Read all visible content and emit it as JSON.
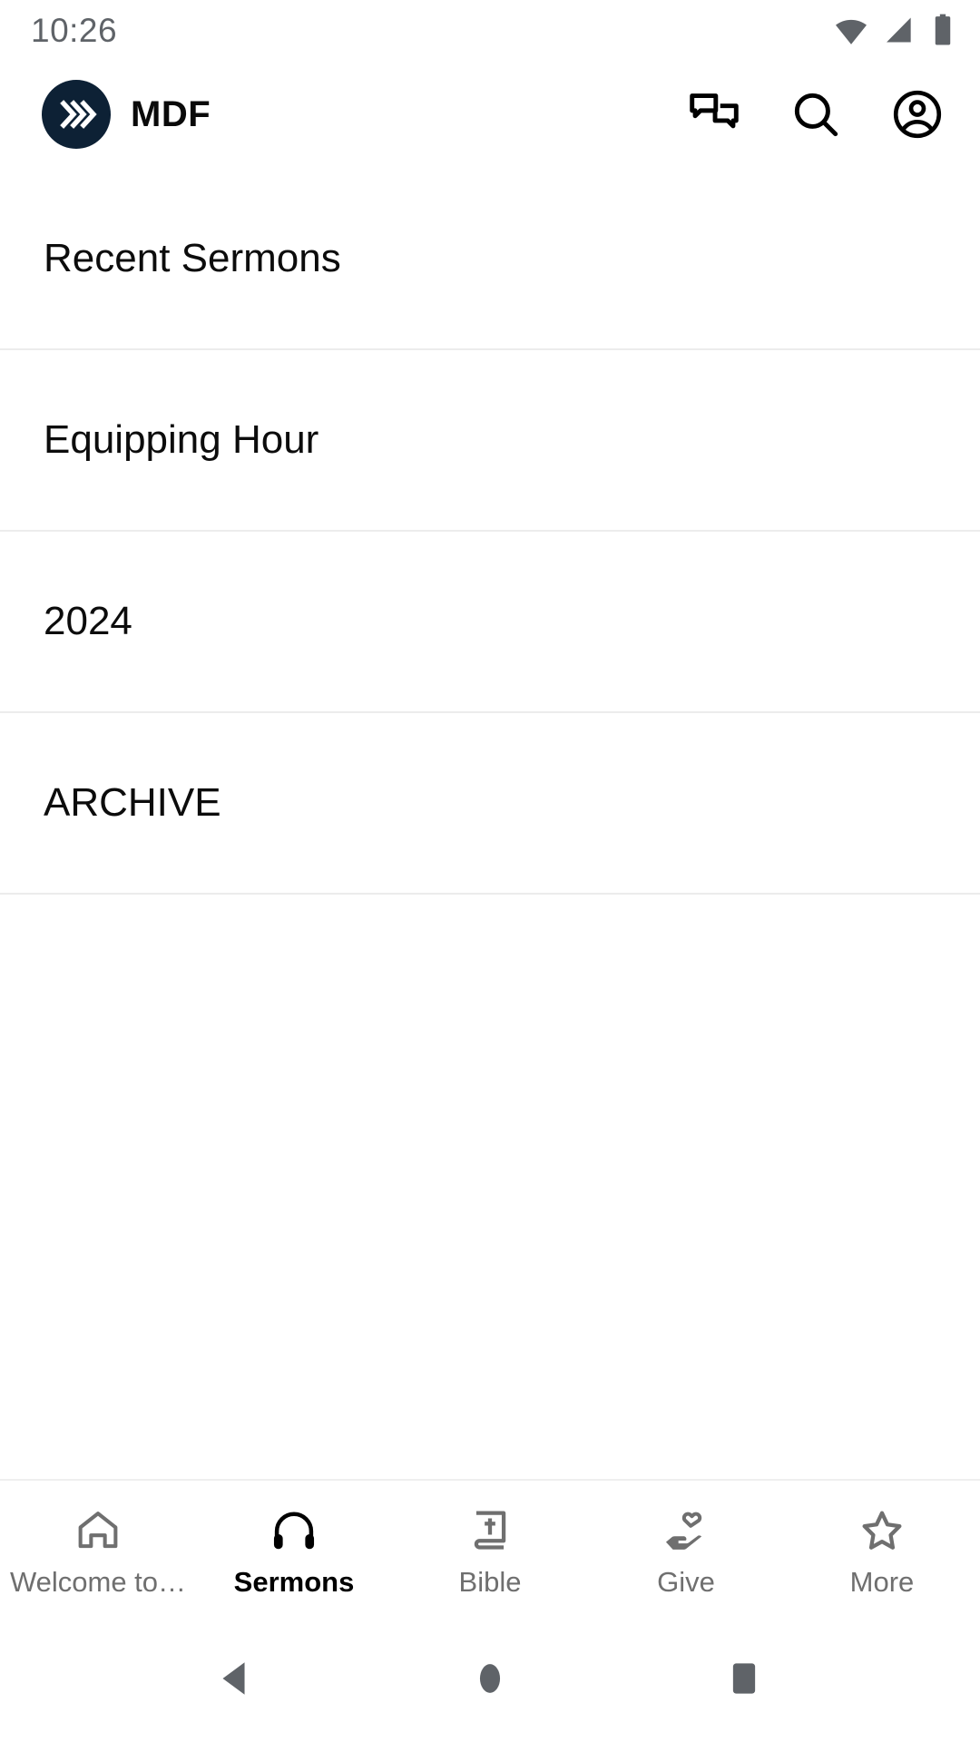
{
  "status_bar": {
    "time": "10:26",
    "icons": [
      "wifi-icon",
      "cellular-signal-icon",
      "battery-icon"
    ]
  },
  "app_bar": {
    "logo_icon": "mdf-chevrons-logo-icon",
    "brand_name": "MDF",
    "actions": [
      {
        "name": "messages-icon",
        "label": "Messages"
      },
      {
        "name": "search-icon",
        "label": "Search"
      },
      {
        "name": "account-circle-icon",
        "label": "Account"
      }
    ]
  },
  "main": {
    "rows": [
      {
        "label": "Recent Sermons"
      },
      {
        "label": "Equipping Hour"
      },
      {
        "label": "2024"
      },
      {
        "label": "ARCHIVE"
      }
    ]
  },
  "bottom_nav": {
    "items": [
      {
        "label": "Welcome to…",
        "icon": "home-icon",
        "active": false
      },
      {
        "label": "Sermons",
        "icon": "headphones-icon",
        "active": true
      },
      {
        "label": "Bible",
        "icon": "bible-book-cross-icon",
        "active": false
      },
      {
        "label": "Give",
        "icon": "hand-heart-icon",
        "active": false
      },
      {
        "label": "More",
        "icon": "star-outline-icon",
        "active": false
      }
    ]
  },
  "system_nav": {
    "buttons": [
      {
        "name": "back-button",
        "label": "Back"
      },
      {
        "name": "home-button",
        "label": "Home"
      },
      {
        "name": "recents-button",
        "label": "Recents"
      }
    ]
  },
  "colors": {
    "brand_navy": "#0d2135",
    "active_text": "#000000",
    "inactive_text": "#6f6f6f",
    "divider": "#ececec",
    "status_gray": "#5f6368"
  }
}
